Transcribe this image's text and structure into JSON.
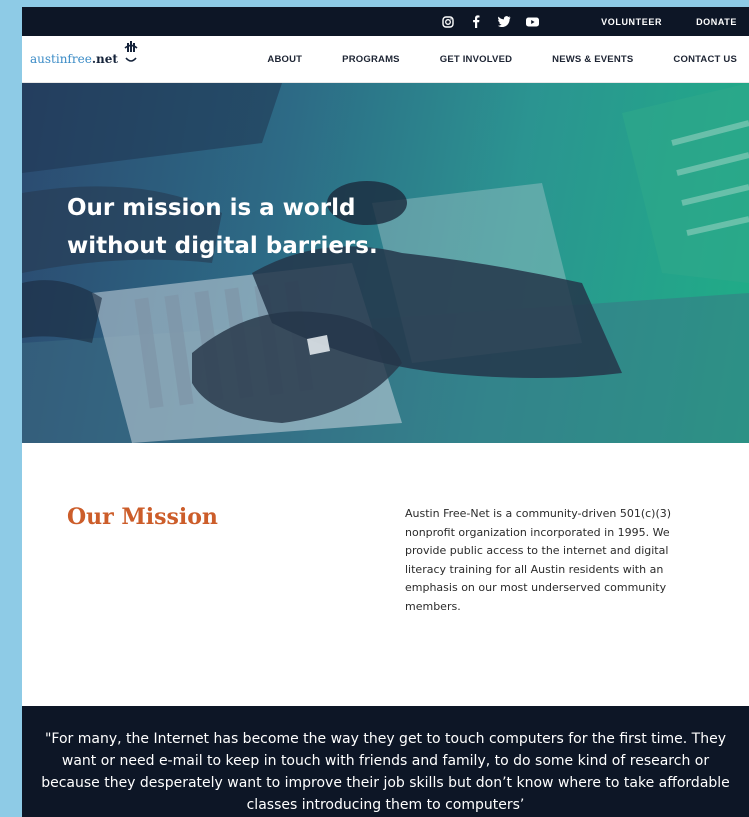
{
  "topbar": {
    "social_icons": [
      "instagram-icon",
      "facebook-icon",
      "twitter-icon",
      "youtube-icon"
    ],
    "links": [
      "VOLUNTEER",
      "DONATE"
    ]
  },
  "logo": {
    "brand": "austinfree",
    "suffix": ".net",
    "mark": "cursor-hand-icon"
  },
  "nav": {
    "items": [
      "ABOUT",
      "PROGRAMS",
      "GET INVOLVED",
      "NEWS & EVENTS",
      "CONTACT US"
    ]
  },
  "hero": {
    "title": "Our mission is a world without digital barriers."
  },
  "mission": {
    "heading": "Our Mission",
    "body": "Austin Free-Net is a community-driven 501(c)(3) nonprofit organization incorporated in 1995. We provide public access to the internet and digital literacy training for all Austin residents with an emphasis on our most underserved community members."
  },
  "quote": {
    "text": "\"For many, the Internet has become the way they get to touch computers for the first time. They want or need e-mail to keep in touch with friends and family, to do some kind of research or because they desperately want to improve their job skills but don’t know where to take affordable classes introducing them to computers’"
  },
  "colors": {
    "dark_navy": "#0d1626",
    "accent_orange": "#cc5d2a",
    "logo_blue": "#3a8bc6",
    "side_blue": "#8ecbe6"
  }
}
